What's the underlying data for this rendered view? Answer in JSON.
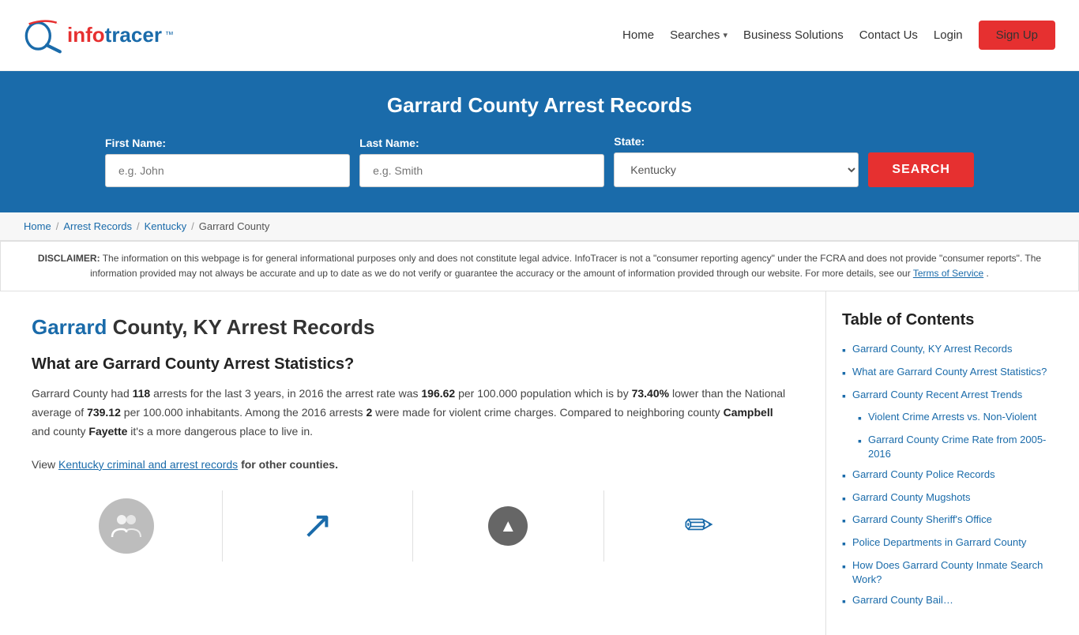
{
  "header": {
    "logo_text_info": "info",
    "logo_text_tracer": "tracer",
    "logo_tm": "™",
    "nav": {
      "home": "Home",
      "searches": "Searches",
      "business_solutions": "Business Solutions",
      "contact_us": "Contact Us",
      "login": "Login",
      "signup": "Sign Up"
    }
  },
  "hero": {
    "title": "Garrard County Arrest Records",
    "first_name_label": "First Name:",
    "first_name_placeholder": "e.g. John",
    "last_name_label": "Last Name:",
    "last_name_placeholder": "e.g. Smith",
    "state_label": "State:",
    "state_value": "Kentucky",
    "search_button": "SEARCH"
  },
  "breadcrumb": {
    "home": "Home",
    "arrest_records": "Arrest Records",
    "kentucky": "Kentucky",
    "current": "Garrard County"
  },
  "disclaimer": {
    "bold": "DISCLAIMER:",
    "text": " The information on this webpage is for general informational purposes only and does not constitute legal advice. InfoTracer is not a \"consumer reporting agency\" under the FCRA and does not provide \"consumer reports\". The information provided may not always be accurate and up to date as we do not verify or guarantee the accuracy or the amount of information provided through our website. For more details, see our ",
    "link_text": "Terms of Service",
    "end": "."
  },
  "article": {
    "title_highlight": "Garrard",
    "title_rest": " County, KY Arrest Records",
    "subtitle": "What are Garrard County Arrest Statistics?",
    "body1": "Garrard County had ",
    "arrests_count": "118",
    "body2": " arrests for the last 3 years, in 2016 the arrest rate was ",
    "rate1": "196.62",
    "body3": " per 100.000 population which is by ",
    "percent": "73.40%",
    "body4": " lower than the National average of ",
    "rate2": "739.12",
    "body5": " per 100.000 inhabitants. Among the 2016 arrests ",
    "violent_count": "2",
    "body6": " were made for violent crime charges. Compared to neighboring county ",
    "county1": "Campbell",
    "body7": " and county ",
    "county2": "Fayette",
    "body8": " it's a more dangerous place to live in.",
    "view_text1": "View ",
    "view_link_text": "Kentucky criminal and arrest records",
    "view_text2": " for other counties."
  },
  "toc": {
    "title": "Table of Contents",
    "items": [
      {
        "text": "Garrard County, KY Arrest Records",
        "sub": false
      },
      {
        "text": "What are Garrard County Arrest Statistics?",
        "sub": false
      },
      {
        "text": "Garrard County Recent Arrest Trends",
        "sub": false
      },
      {
        "text": "Violent Crime Arrests vs. Non-Violent",
        "sub": true
      },
      {
        "text": "Garrard County Crime Rate from 2005-2016",
        "sub": true
      },
      {
        "text": "Garrard County Police Records",
        "sub": false
      },
      {
        "text": "Garrard County Mugshots",
        "sub": false
      },
      {
        "text": "Garrard County Sheriff's Office",
        "sub": false
      },
      {
        "text": "Police Departments in Garrard County",
        "sub": false
      },
      {
        "text": "How Does Garrard County Inmate Search Work?",
        "sub": false
      },
      {
        "text": "Garrard County Bail…",
        "sub": false
      }
    ]
  },
  "colors": {
    "brand_blue": "#1a6baa",
    "brand_red": "#e63030",
    "hero_bg": "#1a6baa"
  }
}
